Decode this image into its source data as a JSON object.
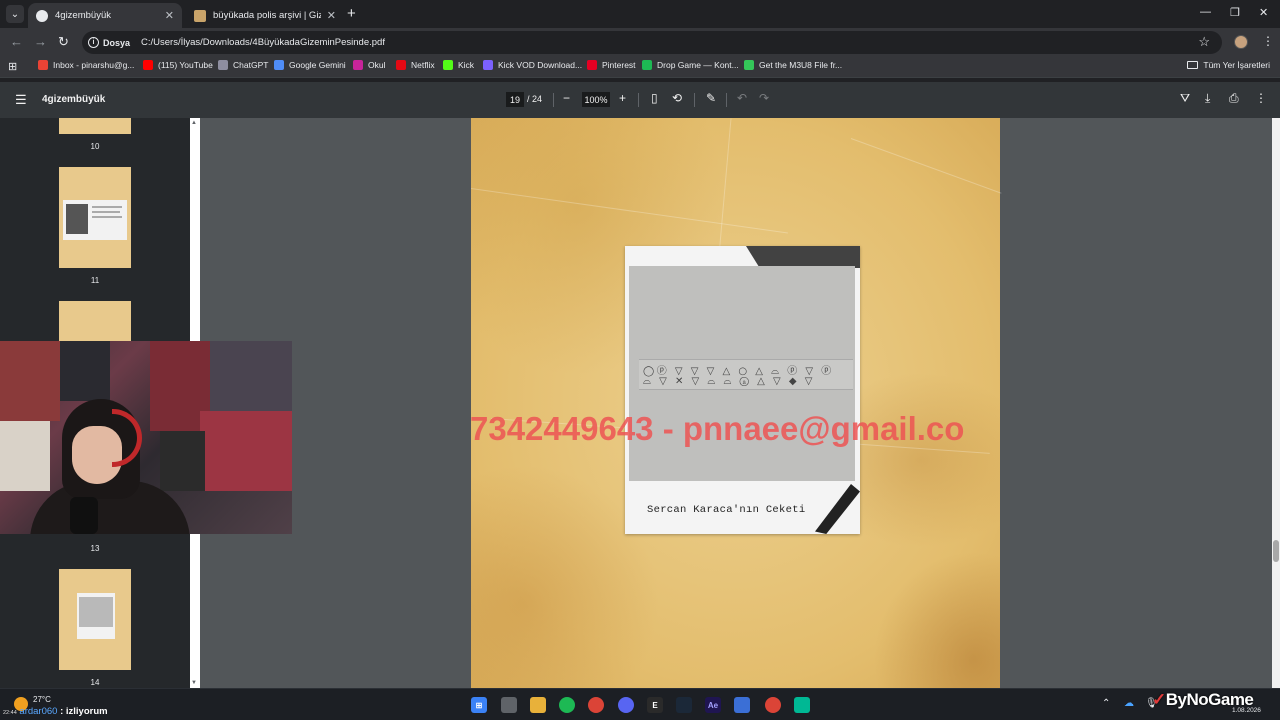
{
  "tabs": [
    {
      "title": "4gizembüyük",
      "active": true
    },
    {
      "title": "büyükada polis arşivi | Gizemin",
      "active": false
    }
  ],
  "address": {
    "chip": "Dosya",
    "url": "C:/Users/İlyas/Downloads/4BüyükadaGizeminPesinde.pdf"
  },
  "bookmarks": [
    {
      "label": "Inbox - pinarshu@g...",
      "icon": "gmail-icon",
      "color": "#ea4335"
    },
    {
      "label": "(115) YouTube",
      "icon": "youtube-icon",
      "color": "#ff0000"
    },
    {
      "label": "ChatGPT",
      "icon": "chatgpt-icon",
      "color": "#8e8ea0"
    },
    {
      "label": "Google Gemini",
      "icon": "gemini-icon",
      "color": "#4f8df7"
    },
    {
      "label": "Okul",
      "icon": "okul-icon",
      "color": "#c8249a"
    },
    {
      "label": "Netflix",
      "icon": "netflix-icon",
      "color": "#e50914"
    },
    {
      "label": "Kick",
      "icon": "kick-icon",
      "color": "#53fc18"
    },
    {
      "label": "Kick VOD Download...",
      "icon": "kick-vod-icon",
      "color": "#7b61ff"
    },
    {
      "label": "Pinterest",
      "icon": "pinterest-icon",
      "color": "#e60023"
    },
    {
      "label": "Drop Game — Kont...",
      "icon": "drop-game-icon",
      "color": "#1db954"
    },
    {
      "label": "Get the M3U8 File fr...",
      "icon": "m3u8-icon",
      "color": "#34c759"
    }
  ],
  "all_bookmarks": "Tüm Yer İşaretleri",
  "pdf": {
    "title": "4gizembüyük",
    "current_page": "19",
    "total_pages": "/ 24",
    "zoom": "100%"
  },
  "thumbnails": [
    {
      "number": "10"
    },
    {
      "number": "11"
    },
    {
      "number": "13"
    },
    {
      "number": "14"
    }
  ],
  "page_content": {
    "care_symbols_row1": "◯ⓟ ▽ ▽ ▽ △ ○ △ ⌓ ⓟ ▽ ⓟ",
    "care_symbols_row2": "⌓ ▽ ✕ ▽ ⌓ ⌓ ⓐ △ ▽ ◆ ▽",
    "caption": "Sercan Karaca'nın Ceketi",
    "watermark": "7342449643 - pnnaee@gmail.co"
  },
  "stream": {
    "temperature": "27°C",
    "clock": "22:44",
    "viewer_name": "ardar060",
    "status": ": izliyorum",
    "brand": "ByNoGame",
    "date": "1.08.2026"
  }
}
